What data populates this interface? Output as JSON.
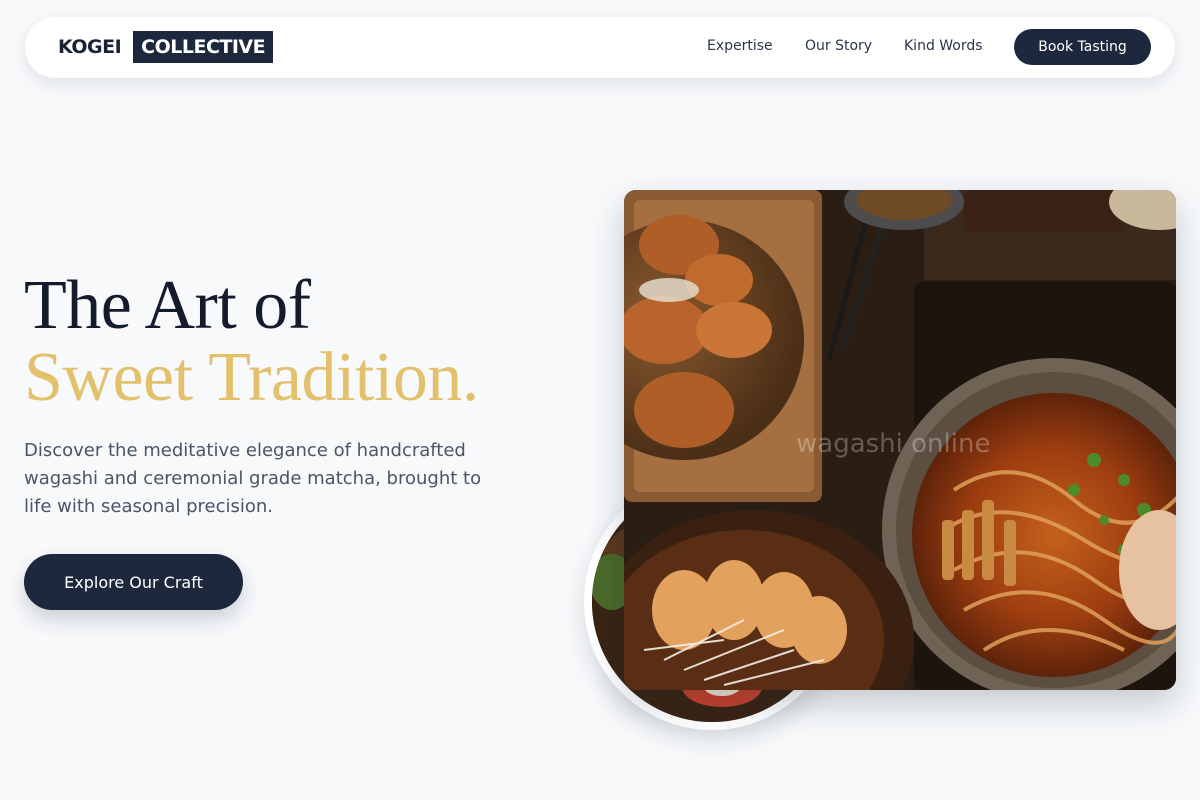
{
  "nav": {
    "logo_part1": "KOGEI",
    "logo_part2": "COLLECTIVE",
    "links": [
      "Expertise",
      "Our Story",
      "Kind Words"
    ],
    "cta_label": "Book Tasting"
  },
  "hero": {
    "title_line1": "The Art of",
    "title_line2": "Sweet Tradition.",
    "description": "Discover the meditative elegance of handcrafted wagashi and ceremonial grade matcha, brought to life with seasonal precision.",
    "cta_label": "Explore Our Craft"
  },
  "images": {
    "main_photo": "food-spread-photo",
    "circle_photo": "gyoza-photo",
    "watermark": "wagashi online"
  },
  "colors": {
    "primary_dark": "#1e283d",
    "accent_gold": "#e2c06c",
    "background": "#f7f9fb"
  }
}
